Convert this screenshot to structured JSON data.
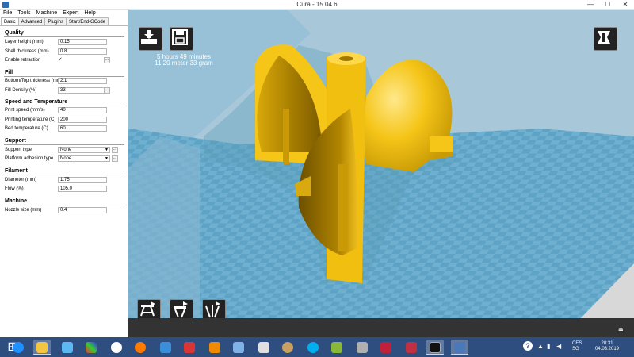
{
  "window": {
    "title": "Cura - 15.04.6",
    "controls": [
      "—",
      "☐",
      "✕"
    ]
  },
  "menu": [
    "File",
    "Tools",
    "Machine",
    "Expert",
    "Help"
  ],
  "tabs": [
    "Basic",
    "Advanced",
    "Plugins",
    "Start/End-GCode"
  ],
  "settings": {
    "quality": {
      "heading": "Quality",
      "layer_height_label": "Layer height (mm)",
      "layer_height": "0.15",
      "shell_thickness_label": "Shell thickness (mm)",
      "shell_thickness": "0.8",
      "enable_retraction_label": "Enable retraction",
      "enable_retraction": "✓"
    },
    "fill": {
      "heading": "Fill",
      "bottom_top_label": "Bottom/Top thickness (mm)",
      "bottom_top": "2.1",
      "fill_density_label": "Fill Density (%)",
      "fill_density": "33"
    },
    "speed": {
      "heading": "Speed and Temperature",
      "print_speed_label": "Print speed (mm/s)",
      "print_speed": "40",
      "print_temp_label": "Printing temperature (C)",
      "print_temp": "200",
      "bed_temp_label": "Bed temperature (C)",
      "bed_temp": "60"
    },
    "support": {
      "heading": "Support",
      "support_type_label": "Support type",
      "support_type": "None",
      "adhesion_label": "Platform adhesion type",
      "adhesion": "None"
    },
    "filament": {
      "heading": "Filament",
      "diameter_label": "Diameter (mm)",
      "diameter": "1.75",
      "flow_label": "Flow (%)",
      "flow": "105.0"
    },
    "machine": {
      "heading": "Machine",
      "nozzle_label": "Nozzle size (mm)",
      "nozzle": "0.4"
    },
    "dots": "..."
  },
  "viewport": {
    "print_time": "5 hours 49 minutes",
    "print_material": "11.20 meter 33 gram",
    "model_color": "#f5c518",
    "bed_color": "#6fb0d0",
    "icons": [
      "load-icon",
      "save-icon",
      "view-mode-icon",
      "rotate-icon",
      "scale-icon",
      "mirror-icon"
    ]
  },
  "taskbar": {
    "apps": [
      "internet-explorer-icon",
      "file-explorer-icon",
      "rocket-icon",
      "media-icon",
      "hp-icon",
      "firefox-icon",
      "app-icon",
      "red-app-icon",
      "vlc-icon",
      "paint-icon",
      "skype-icon",
      "green-app-icon",
      "printer-icon",
      "heart-app-icon",
      "cube-app-icon",
      "terminal-icon",
      "cura-icon"
    ],
    "lang_top": "CES",
    "lang_bottom": "SG",
    "time": "20:31",
    "date": "04.03.2019"
  }
}
